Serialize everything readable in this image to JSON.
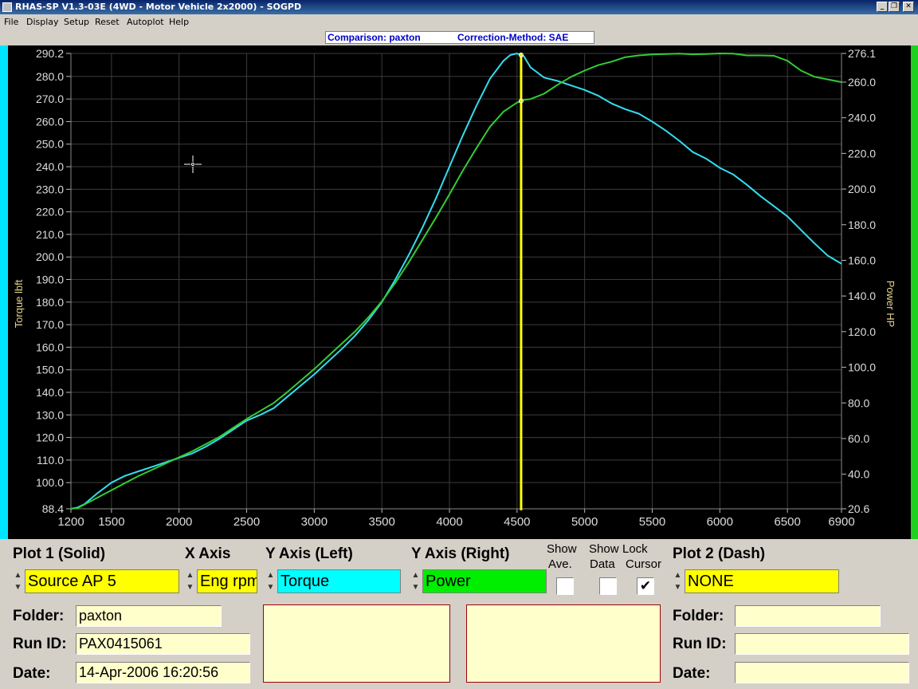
{
  "window": {
    "title": "RHAS-SP V1.3-03E  (4WD - Motor Vehicle 2x2000) - SOGPD",
    "minimize_glyph": "_",
    "restore_glyph": "❐",
    "close_glyph": "✕"
  },
  "menu": [
    "File",
    "Display",
    "Setup",
    "Reset",
    "Autoplot",
    "Help"
  ],
  "infobar": {
    "comparison": "Comparison: paxton",
    "correction": "Correction-Method: SAE"
  },
  "chart_data": {
    "type": "line",
    "xlabel": "",
    "ylabel_left": "Torque  lbft",
    "ylabel_right": "Power HP",
    "xlim": [
      1200,
      6900
    ],
    "ylim_left": [
      88.4,
      290.2
    ],
    "ylim_right": [
      20.6,
      276.1
    ],
    "x_ticks": [
      "1200",
      "1500",
      "2000",
      "2500",
      "3000",
      "3500",
      "4000",
      "4500",
      "5000",
      "5500",
      "6000",
      "6500",
      "6900"
    ],
    "x_tick_values": [
      1200,
      1500,
      2000,
      2500,
      3000,
      3500,
      4000,
      4500,
      5000,
      5500,
      6000,
      6500,
      6900
    ],
    "y_left_ticks": [
      "88.4",
      "100.0",
      "110.0",
      "120.0",
      "130.0",
      "140.0",
      "150.0",
      "160.0",
      "170.0",
      "180.0",
      "190.0",
      "200.0",
      "210.0",
      "220.0",
      "230.0",
      "240.0",
      "250.0",
      "260.0",
      "270.0",
      "280.0",
      "290.2"
    ],
    "y_left_tick_values": [
      88.4,
      100,
      110,
      120,
      130,
      140,
      150,
      160,
      170,
      180,
      190,
      200,
      210,
      220,
      230,
      240,
      250,
      260,
      270,
      280,
      290.2
    ],
    "y_right_ticks": [
      "20.6",
      "40.0",
      "60.0",
      "80.0",
      "100.0",
      "120.0",
      "140.0",
      "160.0",
      "180.0",
      "200.0",
      "220.0",
      "240.0",
      "260.0",
      "276.1"
    ],
    "y_right_tick_values": [
      20.6,
      40,
      60,
      80,
      100,
      120,
      140,
      160,
      180,
      200,
      220,
      240,
      260,
      276.1
    ],
    "grid": true,
    "cursor_x": 4530,
    "series": [
      {
        "name": "Torque",
        "axis": "left",
        "color": "#33ddee",
        "x": [
          1200,
          1250,
          1300,
          1400,
          1500,
          1600,
          1700,
          1800,
          1900,
          2000,
          2100,
          2200,
          2300,
          2400,
          2500,
          2600,
          2700,
          2800,
          2900,
          3000,
          3100,
          3200,
          3300,
          3400,
          3500,
          3600,
          3700,
          3800,
          3900,
          4000,
          4100,
          4200,
          4300,
          4400,
          4450,
          4500,
          4550,
          4600,
          4700,
          4800,
          4900,
          5000,
          5100,
          5200,
          5300,
          5400,
          5500,
          5600,
          5700,
          5800,
          5900,
          6000,
          6100,
          6200,
          6300,
          6400,
          6500,
          6600,
          6700,
          6800,
          6900
        ],
        "values": [
          88.4,
          89,
          90.5,
          95.5,
          100,
          103,
          105,
          107,
          109,
          111,
          113,
          116,
          119.5,
          123.5,
          127.5,
          130,
          133,
          138,
          143,
          148,
          153.5,
          159,
          165,
          172,
          180,
          190,
          201,
          213,
          226,
          240,
          254,
          267,
          279,
          287,
          289.5,
          290.2,
          289,
          284,
          279.5,
          278,
          276,
          274,
          271.5,
          268,
          265.5,
          263.5,
          260,
          256,
          251.5,
          246.5,
          243.5,
          239.5,
          236.5,
          232,
          227,
          222.5,
          218,
          212,
          206,
          200.5,
          197
        ]
      },
      {
        "name": "Power",
        "axis": "right",
        "color": "#33cc33",
        "x": [
          1200,
          1250,
          1300,
          1400,
          1500,
          1600,
          1700,
          1800,
          1900,
          2000,
          2100,
          2200,
          2300,
          2400,
          2500,
          2600,
          2700,
          2800,
          2900,
          3000,
          3100,
          3200,
          3300,
          3400,
          3500,
          3600,
          3700,
          3800,
          3900,
          4000,
          4100,
          4200,
          4300,
          4400,
          4500,
          4550,
          4600,
          4700,
          4800,
          4900,
          5000,
          5100,
          5200,
          5300,
          5400,
          5500,
          5600,
          5700,
          5800,
          5900,
          6000,
          6100,
          6200,
          6300,
          6400,
          6500,
          6600,
          6700,
          6800,
          6900
        ],
        "values": [
          20.6,
          21,
          23,
          27,
          31,
          35,
          39,
          42.5,
          46,
          49.5,
          53,
          57,
          61,
          66,
          71,
          75.5,
          80,
          86,
          92.5,
          99,
          106,
          113,
          120,
          128,
          137,
          147.5,
          159,
          171.5,
          184,
          197,
          210.5,
          223,
          235,
          243.5,
          248.5,
          250,
          250.5,
          253.5,
          258.5,
          263,
          266.5,
          269.5,
          271.5,
          274,
          275,
          275.5,
          275.8,
          276,
          275.6,
          275.8,
          276.1,
          276,
          275,
          275,
          274.8,
          272,
          266.5,
          263,
          261.5,
          260
        ]
      }
    ]
  },
  "controls": {
    "plot1": {
      "label": "Plot 1 (Solid)",
      "value": "Source AP 5"
    },
    "xaxis": {
      "label": "X Axis",
      "value": "Eng rpm"
    },
    "yleft": {
      "label": "Y Axis (Left)",
      "value": "Torque"
    },
    "yright": {
      "label": "Y Axis (Right)",
      "value": "Power"
    },
    "show_ave": {
      "label1": "Show",
      "label2": "Ave.",
      "checked": false
    },
    "show_data": {
      "label1": "Show",
      "label2": "Data",
      "checked": false
    },
    "lock_cursor": {
      "label1": "Lock",
      "label2": "Cursor",
      "checked": true,
      "mark": "✔"
    },
    "plot2": {
      "label": "Plot 2 (Dash)",
      "value": "NONE"
    },
    "spin_up": "▲",
    "spin_down": "▼",
    "colors": {
      "yellow": "#ffff00",
      "cyan": "#00ffff",
      "green": "#00ee00"
    }
  },
  "run1": {
    "folder_label": "Folder:",
    "folder": "paxton",
    "runid_label": "Run ID:",
    "runid": "PAX0415061",
    "date_label": "Date:",
    "date": "14-Apr-2006  16:20:56"
  },
  "run2": {
    "folder_label": "Folder:",
    "folder": "",
    "runid_label": "Run ID:",
    "runid": "",
    "date_label": "Date:",
    "date": ""
  }
}
